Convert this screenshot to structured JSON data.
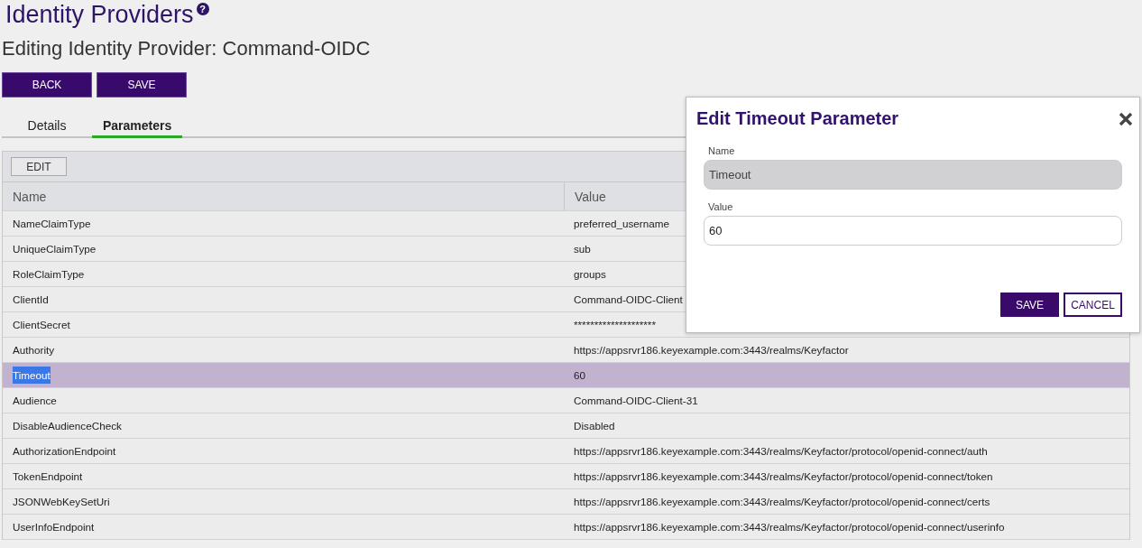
{
  "page": {
    "title": "Identity Providers",
    "help_icon": "?",
    "subtitle": "Editing Identity Provider: Command-OIDC"
  },
  "actions": [
    "BACK",
    "SAVE"
  ],
  "tabs": [
    {
      "label": "Details",
      "selected": false
    },
    {
      "label": "Parameters",
      "selected": true
    }
  ],
  "table": {
    "toolbar_button": "EDIT",
    "columns": [
      "Name",
      "Value"
    ],
    "rows": [
      {
        "name": "NameClaimType",
        "value": "preferred_username",
        "selected": false
      },
      {
        "name": "UniqueClaimType",
        "value": "sub",
        "selected": false
      },
      {
        "name": "RoleClaimType",
        "value": "groups",
        "selected": false
      },
      {
        "name": "ClientId",
        "value": "Command-OIDC-Client",
        "selected": false
      },
      {
        "name": "ClientSecret",
        "value": "********************",
        "selected": false
      },
      {
        "name": "Authority",
        "value": "https://appsrvr186.keyexample.com:3443/realms/Keyfactor",
        "selected": false
      },
      {
        "name": "Timeout",
        "value": "60",
        "selected": true
      },
      {
        "name": "Audience",
        "value": "Command-OIDC-Client-31",
        "selected": false
      },
      {
        "name": "DisableAudienceCheck",
        "value": "Disabled",
        "selected": false
      },
      {
        "name": "AuthorizationEndpoint",
        "value": "https://appsrvr186.keyexample.com:3443/realms/Keyfactor/protocol/openid-connect/auth",
        "selected": false
      },
      {
        "name": "TokenEndpoint",
        "value": "https://appsrvr186.keyexample.com:3443/realms/Keyfactor/protocol/openid-connect/token",
        "selected": false
      },
      {
        "name": "JSONWebKeySetUri",
        "value": "https://appsrvr186.keyexample.com:3443/realms/Keyfactor/protocol/openid-connect/certs",
        "selected": false
      },
      {
        "name": "UserInfoEndpoint",
        "value": "https://appsrvr186.keyexample.com:3443/realms/Keyfactor/protocol/openid-connect/userinfo",
        "selected": false
      }
    ]
  },
  "dialog": {
    "title": "Edit Timeout Parameter",
    "fields": [
      {
        "label": "Name",
        "value": "Timeout",
        "disabled": true
      },
      {
        "label": "Value",
        "value": "60",
        "disabled": false
      }
    ],
    "buttons": [
      {
        "label": "SAVE",
        "kind": "primary"
      },
      {
        "label": "CANCEL",
        "kind": "secondary"
      }
    ]
  }
}
